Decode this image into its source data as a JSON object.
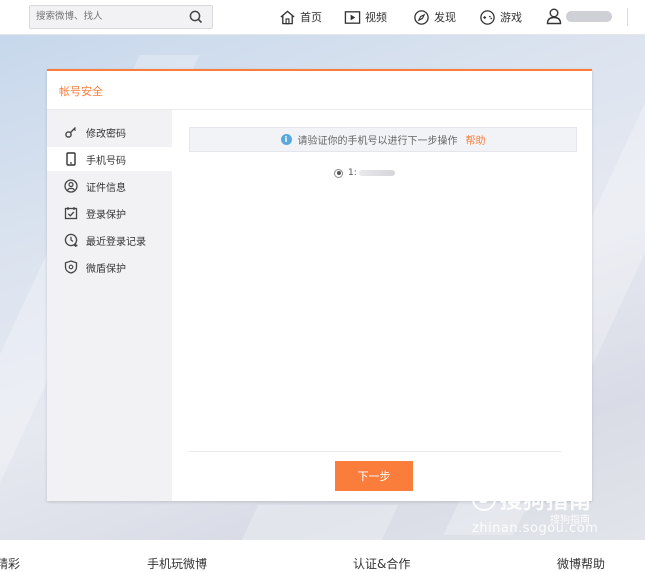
{
  "topbar": {
    "search_placeholder": "搜索微博、找人",
    "nav": [
      {
        "label": "首页",
        "icon": "home-icon"
      },
      {
        "label": "视频",
        "icon": "video-icon"
      },
      {
        "label": "发现",
        "icon": "discover-icon"
      },
      {
        "label": "游戏",
        "icon": "game-icon"
      }
    ]
  },
  "panel": {
    "title": "帐号安全",
    "sidebar": [
      {
        "label": "修改密码",
        "icon": "key-icon",
        "active": false
      },
      {
        "label": "手机号码",
        "icon": "phone-icon",
        "active": true
      },
      {
        "label": "证件信息",
        "icon": "id-icon",
        "active": false
      },
      {
        "label": "登录保护",
        "icon": "login-protect-icon",
        "active": false
      },
      {
        "label": "最近登录记录",
        "icon": "recent-login-icon",
        "active": false
      },
      {
        "label": "微盾保护",
        "icon": "shield-icon",
        "active": false
      }
    ],
    "notice": {
      "text": "请验证你的手机号以进行下一步操作",
      "help": "帮助"
    },
    "phone_prefix": "1:",
    "next_button": "下一步"
  },
  "watermark": {
    "brand": "搜狗指南",
    "sub": "搜狗指南",
    "url": "zhinan.sogou.com"
  },
  "footer": [
    "精彩",
    "手机玩微博",
    "认证&合作",
    "微博帮助"
  ],
  "colors": {
    "accent": "#fa7d3c",
    "info": "#5aa9dd"
  }
}
